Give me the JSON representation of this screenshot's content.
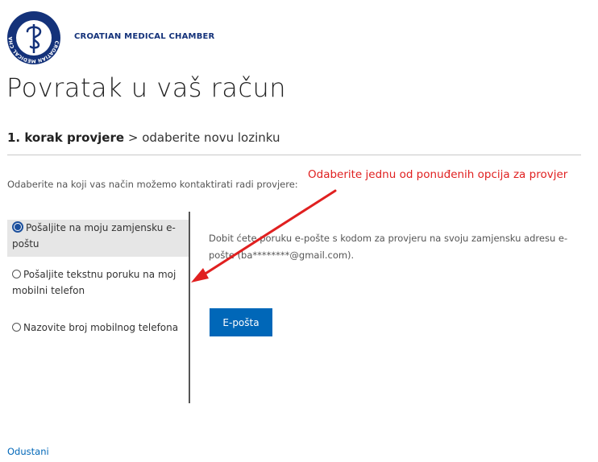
{
  "header": {
    "brand_name": "CROATIAN MEDICAL CHAMBER",
    "logo_icon": "medical-chamber-seal-icon",
    "logo_ring_text": "CROATIAN MEDICAL CHAMBER"
  },
  "page": {
    "title": "Povratak u vaš račun"
  },
  "step": {
    "current": "1. korak provjere",
    "separator": ">",
    "next": "odaberite novu lozinku"
  },
  "instruction": "Odaberite na koji vas način možemo kontaktirati radi provjere:",
  "annotation": {
    "text": "Odaberite jednu od ponuđenih opcija za provjer",
    "color": "#e02020"
  },
  "options": [
    {
      "label": "Pošaljite na moju zamjensku e-poštu",
      "selected": true
    },
    {
      "label": "Pošaljite tekstnu poruku na moj mobilni telefon",
      "selected": false
    },
    {
      "label": "Nazovite broj mobilnog telefona",
      "selected": false
    }
  ],
  "description": "Dobit ćete poruku e-pošte s kodom za provjeru na svoju zamjensku adresu e-pošte (ba********@gmail.com).",
  "actions": {
    "email_button_label": "E-pošta",
    "cancel_label": "Odustani"
  },
  "colors": {
    "accent": "#0067b8",
    "brand": "#14327a"
  }
}
